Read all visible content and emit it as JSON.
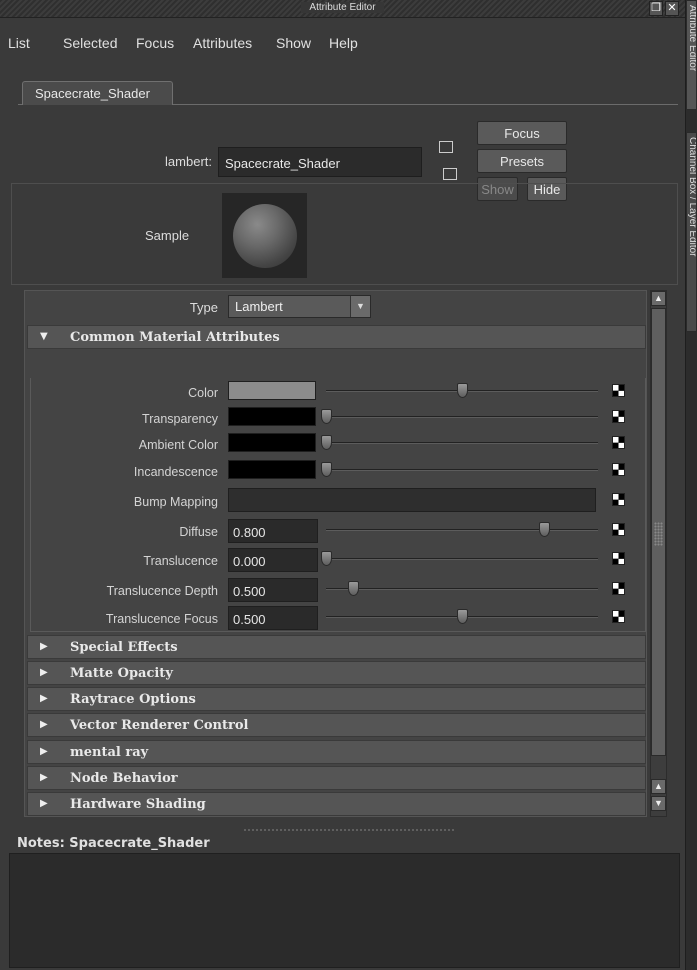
{
  "window": {
    "title": "Attribute Editor",
    "side_tabs": [
      "Attribute Editor",
      "Channel Box / Layer Editor"
    ]
  },
  "menu": {
    "items": [
      "List",
      "Selected",
      "Focus",
      "Attributes",
      "Show",
      "Help"
    ]
  },
  "node_tab": {
    "label": "Spacecrate_Shader"
  },
  "node_header": {
    "type_label": "lambert:",
    "name_value": "Spacecrate_Shader",
    "focus_button": "Focus",
    "presets_button": "Presets",
    "show_button": "Show",
    "hide_button": "Hide"
  },
  "sample": {
    "label": "Sample"
  },
  "type_field": {
    "label": "Type",
    "value": "Lambert"
  },
  "common_section": {
    "label": "Common Material Attributes",
    "expanded": true
  },
  "attributes": [
    {
      "label": "Color",
      "kind": "color",
      "swatch": "#8c8c8c",
      "slider": 0.5
    },
    {
      "label": "Transparency",
      "kind": "color",
      "swatch": "#000000",
      "slider": 0.0
    },
    {
      "label": "Ambient Color",
      "kind": "color",
      "swatch": "#000000",
      "slider": 0.0
    },
    {
      "label": "Incandescence",
      "kind": "color",
      "swatch": "#000000",
      "slider": 0.0
    },
    {
      "label": "Bump Mapping",
      "kind": "map"
    },
    {
      "label": "Diffuse",
      "kind": "number",
      "value": "0.800",
      "slider": 0.8
    },
    {
      "label": "Translucence",
      "kind": "number",
      "value": "0.000",
      "slider": 0.0
    },
    {
      "label": "Translucence Depth",
      "kind": "number",
      "value": "0.500",
      "slider": 0.1
    },
    {
      "label": "Translucence Focus",
      "kind": "number",
      "value": "0.500",
      "slider": 0.5
    }
  ],
  "collapsed_sections": [
    "Special Effects",
    "Matte Opacity",
    "Raytrace Options",
    "Vector Renderer Control",
    "mental ray",
    "Node Behavior",
    "Hardware Shading"
  ],
  "notes": {
    "label": "Notes:  Spacecrate_Shader"
  }
}
